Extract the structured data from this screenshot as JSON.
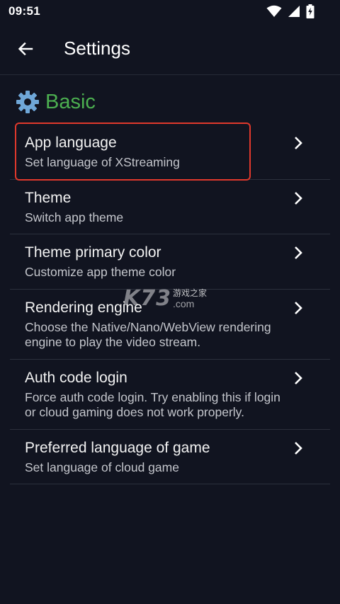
{
  "status_bar": {
    "time": "09:51",
    "icons": [
      "wifi-icon",
      "signal-icon",
      "battery-charging-icon"
    ]
  },
  "app_bar": {
    "back_icon": "arrow-left-icon",
    "title": "Settings"
  },
  "section": {
    "icon": "gear-icon",
    "title": "Basic",
    "title_color": "#4caf50"
  },
  "settings": [
    {
      "title": "App language",
      "desc": "Set language of XStreaming"
    },
    {
      "title": "Theme",
      "desc": "Switch app theme"
    },
    {
      "title": "Theme primary color",
      "desc": "Customize app theme color"
    },
    {
      "title": "Rendering engine",
      "desc": "Choose the Native/Nano/WebView rendering engine to play the video stream."
    },
    {
      "title": "Auth code login",
      "desc": "Force auth code login. Try enabling this if login or cloud gaming does not work properly."
    },
    {
      "title": "Preferred language of game",
      "desc": "Set language of cloud game"
    }
  ],
  "highlight_color": "#e0392c",
  "watermark": {
    "logo": "K73",
    "cn": "游戏之家",
    "com": ".com"
  }
}
